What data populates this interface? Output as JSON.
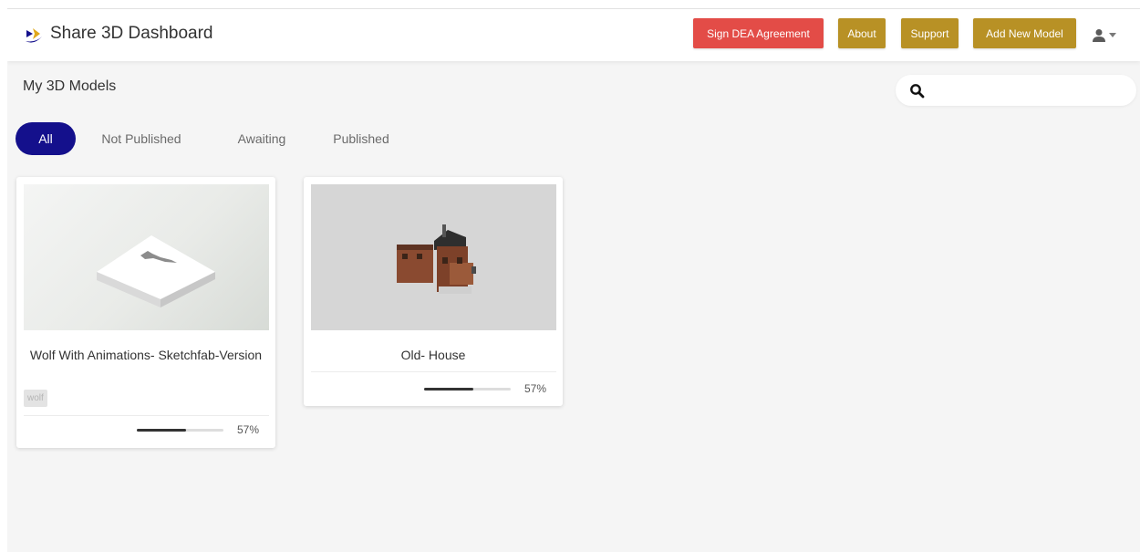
{
  "header": {
    "title": "Share 3D Dashboard",
    "logo_icon": "share3d-logo-icon",
    "buttons": {
      "sign_dea": "Sign DEA Agreement",
      "about": "About",
      "support": "Support",
      "add_model": "Add New Model"
    },
    "user_icon": "user-icon"
  },
  "colors": {
    "primary": "#14108c",
    "danger": "#e34c47",
    "accent": "#b89125",
    "background": "#f5f5f5"
  },
  "page": {
    "title": "My 3D Models"
  },
  "search": {
    "value": "",
    "placeholder": ""
  },
  "tabs": [
    {
      "label": "All",
      "active": true
    },
    {
      "label": "Not Published",
      "active": false
    },
    {
      "label": "Awaiting",
      "active": false
    },
    {
      "label": "Published",
      "active": false
    }
  ],
  "models": [
    {
      "name": "Wolf With Animations- Sketchfab-Version",
      "tag": "wolf",
      "progress": 57,
      "progress_label": "57%"
    },
    {
      "name": "Old- House",
      "tag": "",
      "progress": 57,
      "progress_label": "57%"
    }
  ]
}
